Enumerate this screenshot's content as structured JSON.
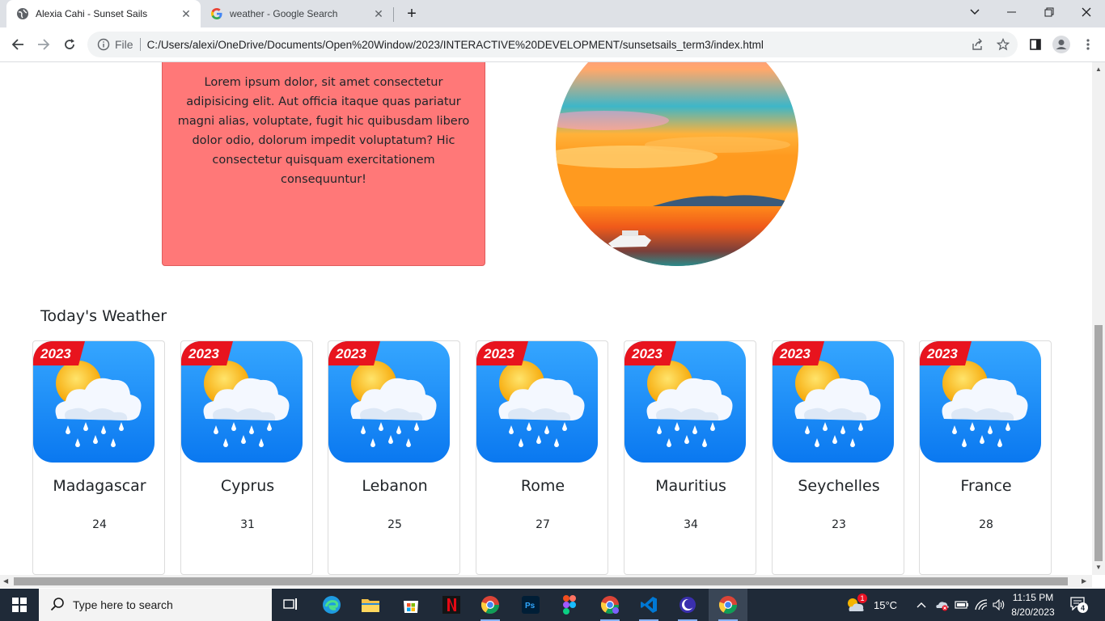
{
  "browser": {
    "tabs": [
      {
        "title": "Alexia Cahi - Sunset Sails",
        "active": true
      },
      {
        "title": "weather - Google Search",
        "active": false
      }
    ],
    "address": {
      "security_label": "File",
      "url": "C:/Users/alexi/OneDrive/Documents/Open%20Window/2023/INTERACTIVE%20DEVELOPMENT/sunsetsails_term3/index.html"
    }
  },
  "page": {
    "intro_text": "Lorem ipsum dolor, sit amet consectetur adipisicing elit. Aut officia itaque quas pariatur magni alias, voluptate, fugit hic quibusdam libero dolor odio, dolorum impedit voluptatum? Hic consectetur quisquam exercitationem consequuntur!",
    "weather_heading": "Today's Weather",
    "weather_badge": "2023",
    "weather_cards": [
      {
        "city": "Madagascar",
        "temp": "24"
      },
      {
        "city": "Cyprus",
        "temp": "31"
      },
      {
        "city": "Lebanon",
        "temp": "25"
      },
      {
        "city": "Rome",
        "temp": "27"
      },
      {
        "city": "Mauritius",
        "temp": "34"
      },
      {
        "city": "Seychelles",
        "temp": "23"
      },
      {
        "city": "France",
        "temp": "28"
      }
    ]
  },
  "taskbar": {
    "search_placeholder": "Type here to search",
    "weather_temp": "15°C",
    "weather_alert_count": "1",
    "time": "11:15 PM",
    "date": "8/20/2023",
    "notification_count": "4"
  },
  "colors": {
    "card_red": "#ff7878",
    "weather_blue": "#1e8cff",
    "badge_red": "#e8141e",
    "taskbar": "#1f2a38"
  }
}
